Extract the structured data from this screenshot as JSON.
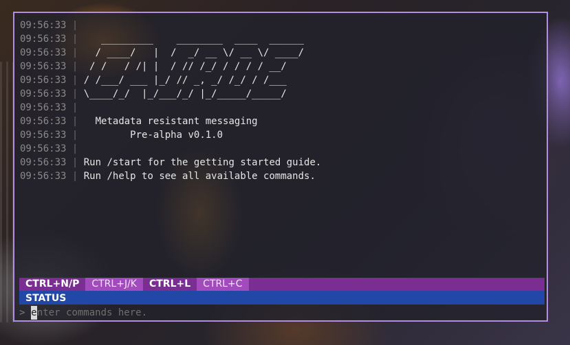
{
  "colors": {
    "border": "#b48ee0",
    "keybar": "#7b2e91",
    "keybar_alt": "#a24bbd",
    "status": "#2148a6",
    "timestamp": "#8a8a8a",
    "text": "#e6e6e6"
  },
  "log": [
    {
      "time": "09:56:33",
      "sep": "|",
      "text": ""
    },
    {
      "time": "09:56:33",
      "sep": "|",
      "text": "   _________    ________  ____  ______"
    },
    {
      "time": "09:56:33",
      "sep": "|",
      "text": "  / ____/   |  /  _/ __ \\/ __ \\/ ____/"
    },
    {
      "time": "09:56:33",
      "sep": "|",
      "text": " / /   / /| |  / // /_/ / / / / __/"
    },
    {
      "time": "09:56:33",
      "sep": "|",
      "text": "/ /___/ ___ |_/ // _, _/ /_/ / /___"
    },
    {
      "time": "09:56:33",
      "sep": "|",
      "text": "\\____/_/  |_/___/_/ |_/_____/_____/"
    },
    {
      "time": "09:56:33",
      "sep": "|",
      "text": ""
    },
    {
      "time": "09:56:33",
      "sep": "|",
      "text": "  Metadata resistant messaging"
    },
    {
      "time": "09:56:33",
      "sep": "|",
      "text": "        Pre-alpha v0.1.0"
    },
    {
      "time": "09:56:33",
      "sep": "|",
      "text": ""
    },
    {
      "time": "09:56:33",
      "sep": "|",
      "text": "Run /start for the getting started guide."
    },
    {
      "time": "09:56:33",
      "sep": "|",
      "text": "Run /help to see all available commands."
    }
  ],
  "keybar": [
    {
      "label": "CTRL+N/P"
    },
    {
      "label": "CTRL+J/K"
    },
    {
      "label": "CTRL+L"
    },
    {
      "label": "CTRL+C"
    }
  ],
  "status": {
    "label": "STATUS"
  },
  "command": {
    "prompt": ">",
    "cursor_char": "e",
    "placeholder": "nter commands here."
  }
}
